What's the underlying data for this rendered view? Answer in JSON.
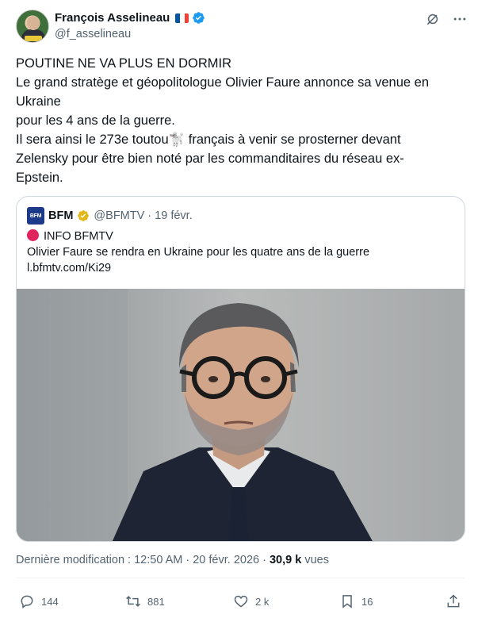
{
  "author": {
    "display_name": "François Asselineau",
    "handle": "@f_asselineau",
    "flag_colors": [
      "#0055A4",
      "#FFFFFF",
      "#EF4135"
    ],
    "verified_color": "#1d9bf0"
  },
  "header_icons": [
    "grok-icon",
    "more-icon"
  ],
  "tweet": {
    "lines": [
      "POUTINE NE VA PLUS EN DORMIR",
      "Le grand stratège et géopolitologue Olivier Faure annonce sa venue en",
      "Ukraine",
      "pour les 4 ans de la guerre.",
      "Il sera ainsi le 273e toutou🐩 français à venir se prosterner devant",
      "Zelensky pour être bien noté par les commanditaires du réseau ex-",
      "Epstein."
    ]
  },
  "quote": {
    "logo_text": "BFM",
    "name": "BFM",
    "verified_color": "#e2b719",
    "meta": "@BFMTV · 19 févr.",
    "line1": "INFO BFMTV",
    "line2": "Olivier Faure se rendra en Ukraine pour les quatre ans de la guerre",
    "link": "l.bfmtv.com/Ki29"
  },
  "footer": {
    "modified": "Dernière modification : 12:50 AM · 20 févr. 2026 · ",
    "views_count": "30,9 k",
    "views_label": " vues"
  },
  "actions": {
    "replies": "144",
    "reposts": "881",
    "likes": "2 k",
    "bookmarks": "16"
  }
}
